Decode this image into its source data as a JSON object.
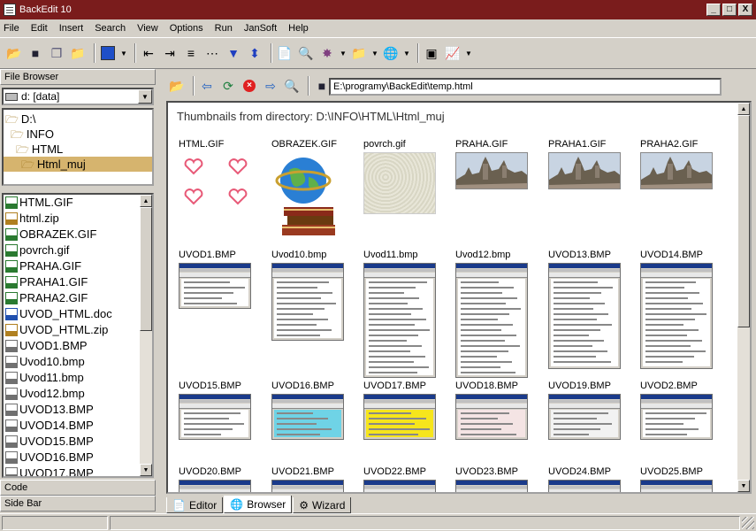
{
  "window": {
    "title": "BackEdit 10",
    "min": "_",
    "max": "□",
    "close": "X"
  },
  "menu": [
    "File",
    "Edit",
    "Insert",
    "Search",
    "View",
    "Options",
    "Run",
    "JanSoft",
    "Help"
  ],
  "left": {
    "file_browser_label": "File Browser",
    "drive": "d: [data]",
    "tree": [
      {
        "label": "D:\\",
        "indent": 0,
        "selected": false
      },
      {
        "label": "INFO",
        "indent": 1,
        "selected": false
      },
      {
        "label": "HTML",
        "indent": 2,
        "selected": false
      },
      {
        "label": "Html_muj",
        "indent": 3,
        "selected": true
      }
    ],
    "files": [
      {
        "name": "HTML.GIF",
        "kind": "gif"
      },
      {
        "name": "html.zip",
        "kind": "zip"
      },
      {
        "name": "OBRAZEK.GIF",
        "kind": "gif"
      },
      {
        "name": "povrch.gif",
        "kind": "gif"
      },
      {
        "name": "PRAHA.GIF",
        "kind": "gif"
      },
      {
        "name": "PRAHA1.GIF",
        "kind": "gif"
      },
      {
        "name": "PRAHA2.GIF",
        "kind": "gif"
      },
      {
        "name": "UVOD_HTML.doc",
        "kind": "doc"
      },
      {
        "name": "UVOD_HTML.zip",
        "kind": "zip"
      },
      {
        "name": "UVOD1.BMP",
        "kind": "bmp"
      },
      {
        "name": "Uvod10.bmp",
        "kind": "bmp"
      },
      {
        "name": "Uvod11.bmp",
        "kind": "bmp"
      },
      {
        "name": "Uvod12.bmp",
        "kind": "bmp"
      },
      {
        "name": "UVOD13.BMP",
        "kind": "bmp"
      },
      {
        "name": "UVOD14.BMP",
        "kind": "bmp"
      },
      {
        "name": "UVOD15.BMP",
        "kind": "bmp"
      },
      {
        "name": "UVOD16.BMP",
        "kind": "bmp"
      },
      {
        "name": "UVOD17.BMP",
        "kind": "bmp"
      }
    ],
    "code_label": "Code",
    "sidebar_label": "Side Bar"
  },
  "address": "E:\\programy\\BackEdit\\temp.html",
  "heading": "Thumbnails from directory: D:\\INFO\\HTML\\Html_muj",
  "thumbnails": [
    {
      "name": "HTML.GIF",
      "kind": "hearts"
    },
    {
      "name": "OBRAZEK.GIF",
      "kind": "globe"
    },
    {
      "name": "povrch.gif",
      "kind": "texture"
    },
    {
      "name": "PRAHA.GIF",
      "kind": "castle"
    },
    {
      "name": "PRAHA1.GIF",
      "kind": "castle"
    },
    {
      "name": "PRAHA2.GIF",
      "kind": "castle"
    },
    {
      "name": "UVOD1.BMP",
      "kind": "shot",
      "h": 52,
      "fill": "#ffffff"
    },
    {
      "name": "Uvod10.bmp",
      "kind": "shot",
      "h": 88,
      "fill": "#ffffff"
    },
    {
      "name": "Uvod11.bmp",
      "kind": "shot",
      "h": 130,
      "fill": "#ffffff"
    },
    {
      "name": "Uvod12.bmp",
      "kind": "shot",
      "h": 130,
      "fill": "#ffffff"
    },
    {
      "name": "UVOD13.BMP",
      "kind": "shot",
      "h": 120,
      "fill": "#ffffff"
    },
    {
      "name": "UVOD14.BMP",
      "kind": "shot",
      "h": 120,
      "fill": "#ffffff"
    },
    {
      "name": "UVOD15.BMP",
      "kind": "shot",
      "h": 52,
      "fill": "#ffffff"
    },
    {
      "name": "UVOD16.BMP",
      "kind": "shot",
      "h": 52,
      "fill": "#6fd3e6"
    },
    {
      "name": "UVOD17.BMP",
      "kind": "shot",
      "h": 52,
      "fill": "#f6e51c"
    },
    {
      "name": "UVOD18.BMP",
      "kind": "shot",
      "h": 52,
      "fill": "#f4e4e4"
    },
    {
      "name": "UVOD19.BMP",
      "kind": "shot",
      "h": 52,
      "fill": "#f2f2f2"
    },
    {
      "name": "UVOD2.BMP",
      "kind": "shot",
      "h": 52,
      "fill": "#ffffff"
    },
    {
      "name": "UVOD20.BMP",
      "kind": "shot",
      "h": 20,
      "fill": "#ffffff"
    },
    {
      "name": "UVOD21.BMP",
      "kind": "shot",
      "h": 20,
      "fill": "#ffffff"
    },
    {
      "name": "UVOD22.BMP",
      "kind": "shot",
      "h": 20,
      "fill": "#ffffff"
    },
    {
      "name": "UVOD23.BMP",
      "kind": "shot",
      "h": 20,
      "fill": "#ffffff"
    },
    {
      "name": "UVOD24.BMP",
      "kind": "shot",
      "h": 20,
      "fill": "#ffffff"
    },
    {
      "name": "UVOD25.BMP",
      "kind": "shot",
      "h": 20,
      "fill": "#ffffff"
    }
  ],
  "tabs": [
    {
      "label": "Editor",
      "active": false,
      "icon": "editor-icon"
    },
    {
      "label": "Browser",
      "active": true,
      "icon": "globe-icon"
    },
    {
      "label": "Wizard",
      "active": false,
      "icon": "wizard-icon"
    }
  ],
  "colors": {
    "titlebar": "#7a1c1c",
    "selection": "#d6b46e",
    "face": "#d4d0c8"
  }
}
